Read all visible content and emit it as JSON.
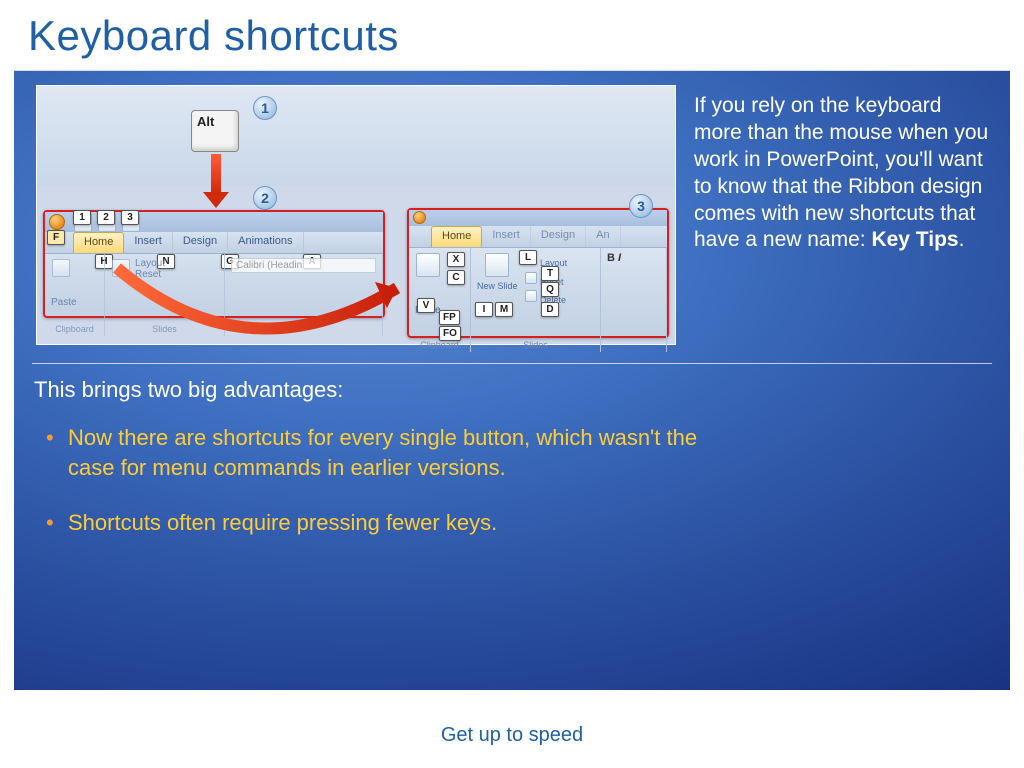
{
  "title": "Keyboard shortcuts",
  "paragraph": {
    "pre": "If you rely on the keyboard more than the mouse when you work in PowerPoint, you'll want to know that the Ribbon design comes with new shortcuts that have a new name: ",
    "bold": "Key Tips",
    "post": "."
  },
  "subhead": "This brings two big advantages:",
  "bullets": [
    "Now there are shortcuts for every single button, which wasn't the case for menu commands in earlier versions.",
    "Shortcuts often require pressing fewer keys."
  ],
  "footer": "Get up to speed",
  "illus": {
    "alt_key": "Alt",
    "callouts": [
      "1",
      "2",
      "3"
    ],
    "key_tips_left_office": "F",
    "key_tips_left_qat": [
      "1",
      "2",
      "3"
    ],
    "key_tips_left_tabs": [
      "H",
      "N",
      "G",
      "A"
    ],
    "tabs_left": [
      "Home",
      "Insert",
      "Design",
      "Animations"
    ],
    "tabs_right": [
      "Home",
      "Insert",
      "Design",
      "An"
    ],
    "groups_left": [
      "Clipboard",
      "Slides"
    ],
    "groups_right": [
      "Clipboard",
      "Slides"
    ],
    "right_buttons": {
      "paste": "Paste",
      "new_slide": "New Slide",
      "delete": "Delete",
      "layout": "Layout",
      "reset": "Reset"
    },
    "left_buttons": {
      "paste": "Paste",
      "layout": "Layout",
      "reset": "Reset",
      "font": "Calibri (Headin"
    },
    "key_tips_right": [
      "V",
      "FP",
      "FO",
      "X",
      "C",
      "L",
      "I",
      "T",
      "Q",
      "D",
      "M"
    ]
  }
}
